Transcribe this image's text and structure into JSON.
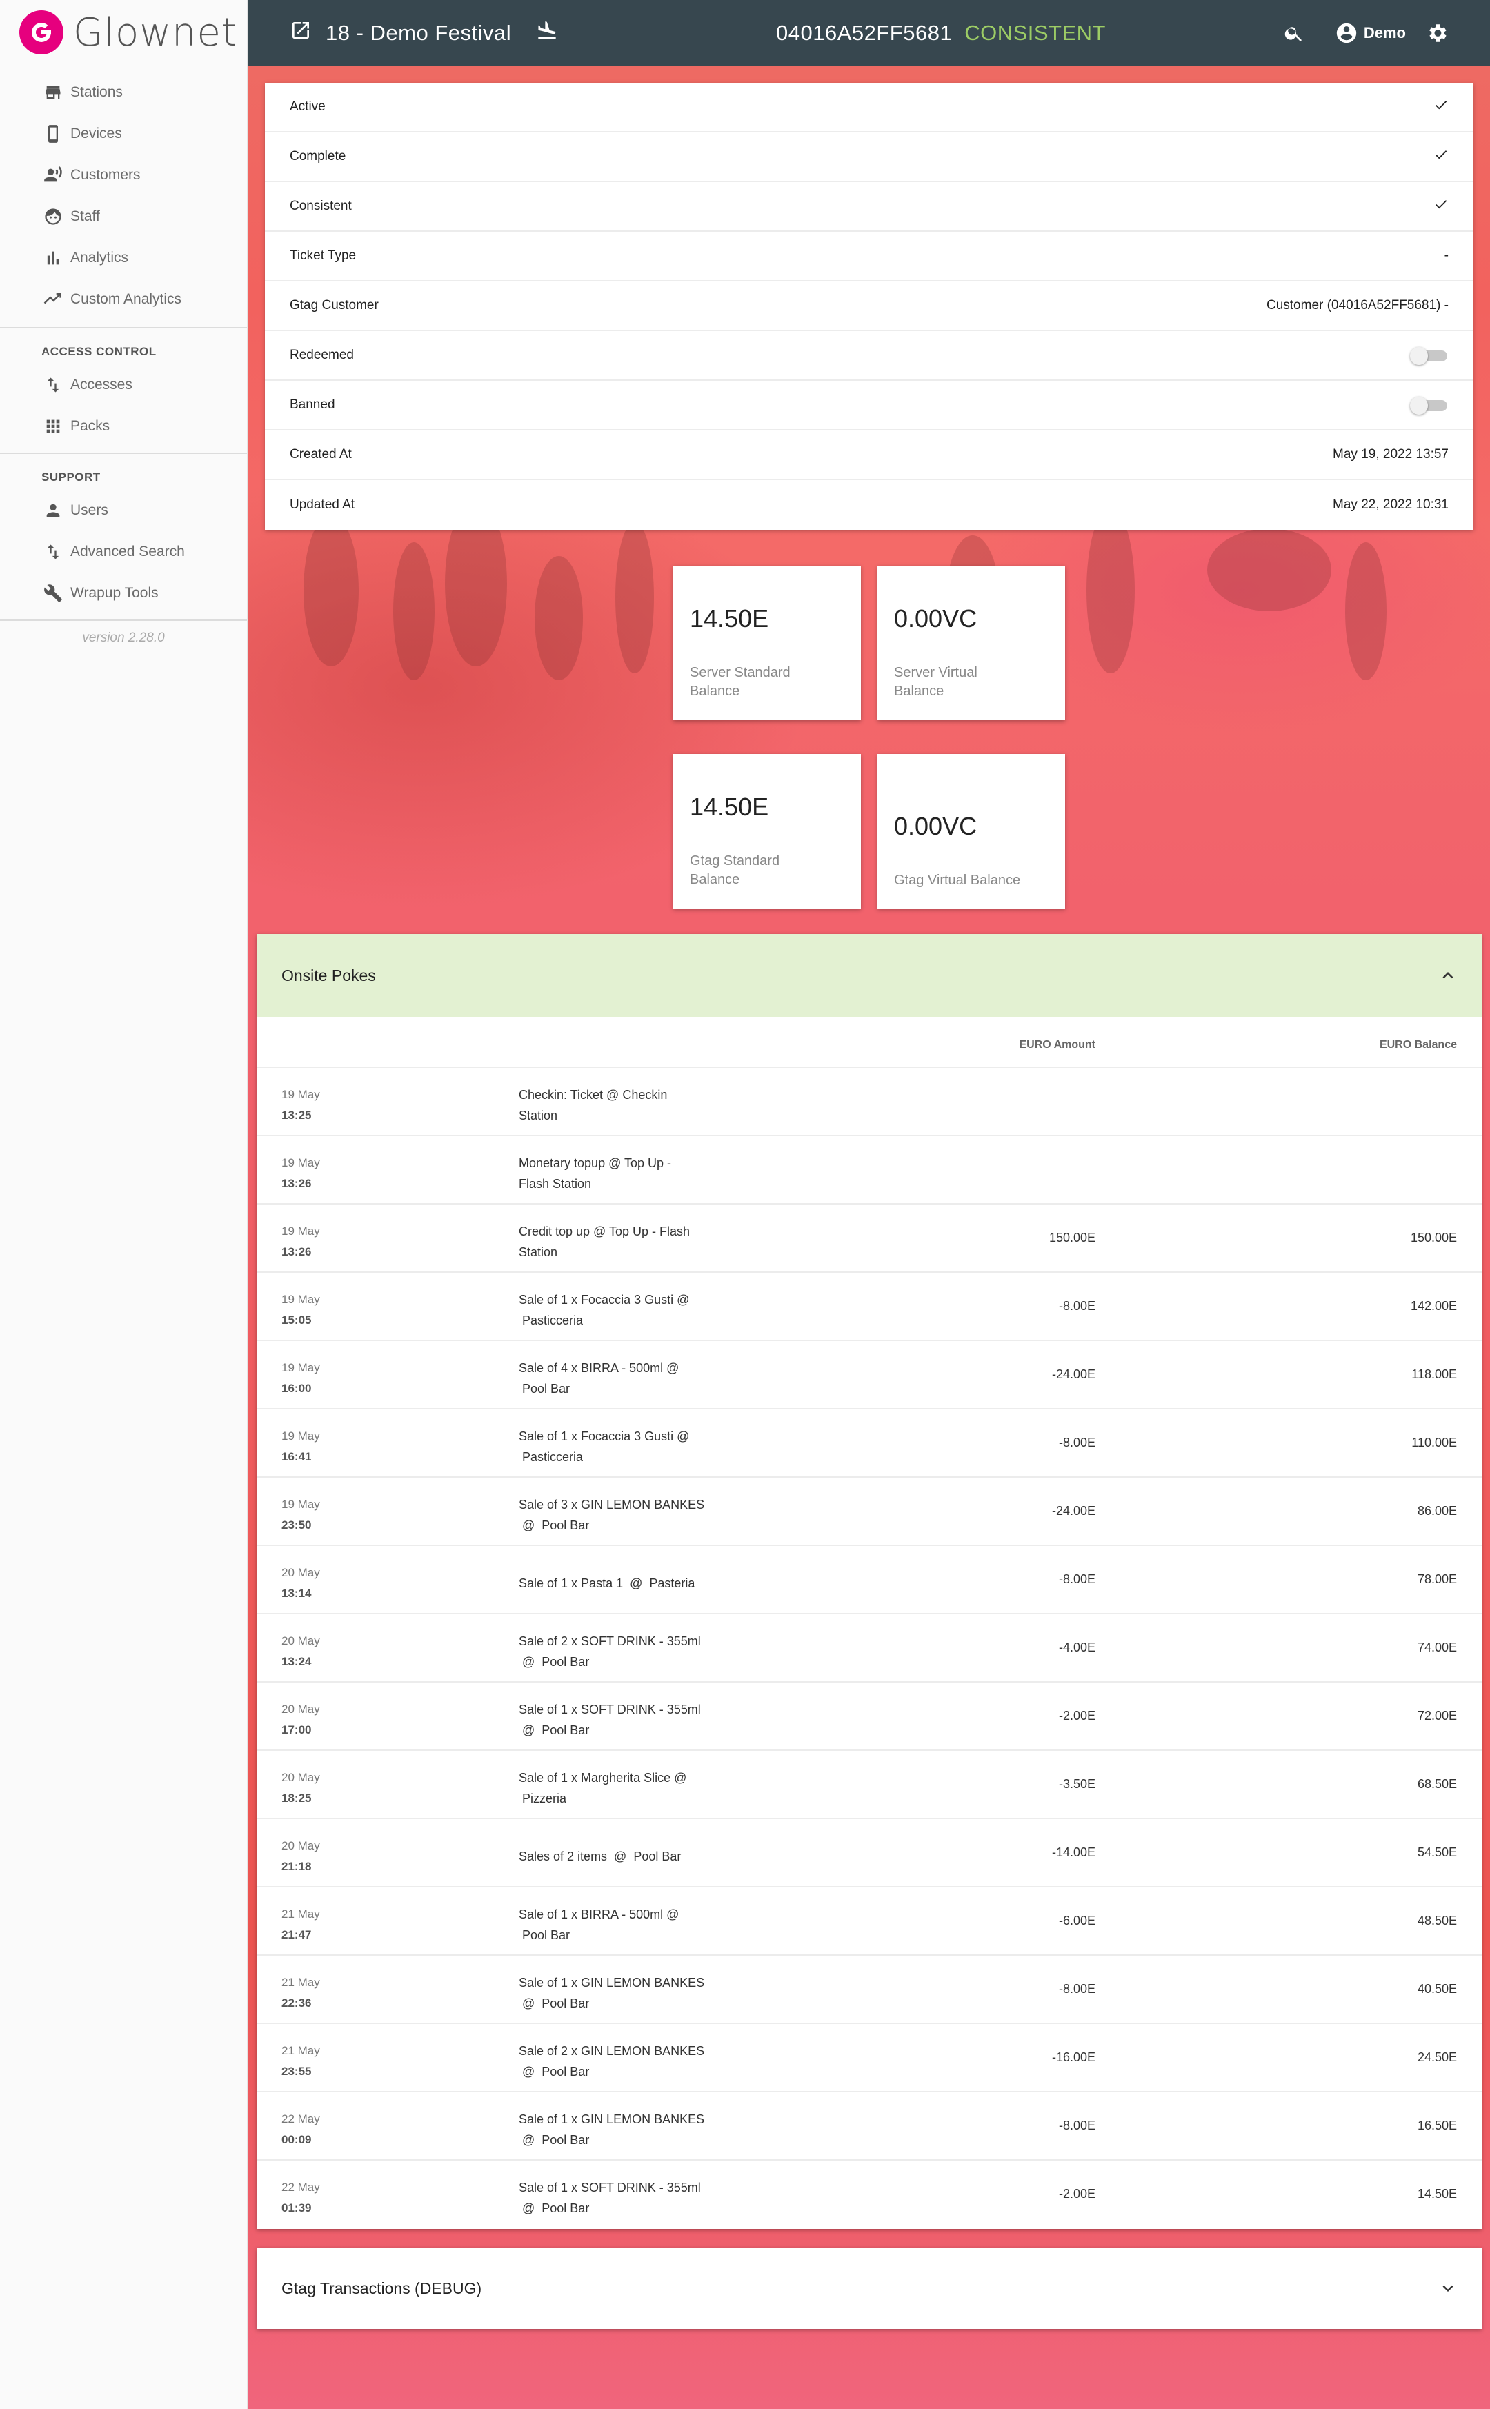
{
  "brand": {
    "name": "Glownet",
    "color": "#e6007e"
  },
  "sidebar": {
    "items": [
      {
        "label": "Stations",
        "icon": "store-icon"
      },
      {
        "label": "Devices",
        "icon": "phone-icon"
      },
      {
        "label": "Customers",
        "icon": "customers-icon"
      },
      {
        "label": "Staff",
        "icon": "face-icon"
      },
      {
        "label": "Analytics",
        "icon": "bar-chart-icon"
      },
      {
        "label": "Custom Analytics",
        "icon": "trend-icon"
      }
    ],
    "access_heading": "ACCESS CONTROL",
    "access_items": [
      {
        "label": "Accesses",
        "icon": "swap-icon"
      },
      {
        "label": "Packs",
        "icon": "grid-icon"
      }
    ],
    "support_heading": "SUPPORT",
    "support_items": [
      {
        "label": "Users",
        "icon": "person-icon"
      },
      {
        "label": "Advanced Search",
        "icon": "swap-icon"
      },
      {
        "label": "Wrapup Tools",
        "icon": "wrench-icon"
      }
    ],
    "version": "version 2.28.0"
  },
  "topbar": {
    "event": "18 - Demo Festival",
    "gtag_uid": "04016A52FF5681",
    "status": "CONSISTENT",
    "status_color": "#9ccc65",
    "user": "Demo"
  },
  "details": [
    {
      "label": "Active",
      "value": "",
      "kind": "check"
    },
    {
      "label": "Complete",
      "value": "",
      "kind": "check"
    },
    {
      "label": "Consistent",
      "value": "",
      "kind": "check"
    },
    {
      "label": "Ticket Type",
      "value": "-",
      "kind": "text"
    },
    {
      "label": "Gtag Customer",
      "value": "Customer (04016A52FF5681) -",
      "kind": "text"
    },
    {
      "label": "Redeemed",
      "value": "",
      "kind": "toggle"
    },
    {
      "label": "Banned",
      "value": "",
      "kind": "toggle"
    },
    {
      "label": "Created At",
      "value": "May 19, 2022 13:57",
      "kind": "text"
    },
    {
      "label": "Updated At",
      "value": "May 22, 2022 10:31",
      "kind": "text"
    }
  ],
  "balances": {
    "server_standard": {
      "amount": "14.50E",
      "label": "Server Standard Balance"
    },
    "server_virtual": {
      "amount": "0.00VC",
      "label": "Server Virtual Balance"
    },
    "gtag_standard": {
      "amount": "14.50E",
      "label": "Gtag Standard Balance"
    },
    "gtag_virtual": {
      "amount": "0.00VC",
      "label": "Gtag Virtual Balance"
    }
  },
  "pokes": {
    "title": "Onsite Pokes",
    "columns": {
      "amount": "EURO Amount",
      "balance": "EURO Balance"
    },
    "rows": [
      {
        "day": "19 May",
        "time": "13:25",
        "desc1": "Checkin: Ticket  @  Checkin",
        "desc2": "Station",
        "amount": "",
        "balance": ""
      },
      {
        "day": "19 May",
        "time": "13:26",
        "desc1": "Monetary topup  @  Top Up -",
        "desc2": "Flash Station",
        "amount": "",
        "balance": ""
      },
      {
        "day": "19 May",
        "time": "13:26",
        "desc1": "Credit top up  @  Top Up - Flash",
        "desc2": "Station",
        "amount": "150.00E",
        "balance": "150.00E"
      },
      {
        "day": "19 May",
        "time": "15:05",
        "desc1": "Sale of 1 x Focaccia 3 Gusti  @",
        "desc2": " Pasticceria",
        "amount": "-8.00E",
        "balance": "142.00E"
      },
      {
        "day": "19 May",
        "time": "16:00",
        "desc1": "Sale of 4 x BIRRA - 500ml  @",
        "desc2": " Pool Bar",
        "amount": "-24.00E",
        "balance": "118.00E"
      },
      {
        "day": "19 May",
        "time": "16:41",
        "desc1": "Sale of 1 x Focaccia 3 Gusti  @",
        "desc2": " Pasticceria",
        "amount": "-8.00E",
        "balance": "110.00E"
      },
      {
        "day": "19 May",
        "time": "23:50",
        "desc1": "Sale of 3 x GIN LEMON BANKES",
        "desc2": " @  Pool Bar",
        "amount": "-24.00E",
        "balance": "86.00E"
      },
      {
        "day": "20 May",
        "time": "13:14",
        "desc1": "",
        "desc2": "Sale of 1 x Pasta 1  @  Pasteria",
        "amount": "-8.00E",
        "balance": "78.00E",
        "single": true
      },
      {
        "day": "20 May",
        "time": "13:24",
        "desc1": "Sale of 2 x SOFT DRINK - 355ml",
        "desc2": " @  Pool Bar",
        "amount": "-4.00E",
        "balance": "74.00E"
      },
      {
        "day": "20 May",
        "time": "17:00",
        "desc1": "Sale of 1 x SOFT DRINK - 355ml",
        "desc2": " @  Pool Bar",
        "amount": "-2.00E",
        "balance": "72.00E"
      },
      {
        "day": "20 May",
        "time": "18:25",
        "desc1": "Sale of 1 x Margherita Slice  @",
        "desc2": " Pizzeria",
        "amount": "-3.50E",
        "balance": "68.50E"
      },
      {
        "day": "20 May",
        "time": "21:18",
        "desc1": "",
        "desc2": "Sales of 2 items  @  Pool Bar",
        "amount": "-14.00E",
        "balance": "54.50E",
        "single": true
      },
      {
        "day": "21 May",
        "time": "21:47",
        "desc1": "Sale of 1 x BIRRA - 500ml  @",
        "desc2": " Pool Bar",
        "amount": "-6.00E",
        "balance": "48.50E"
      },
      {
        "day": "21 May",
        "time": "22:36",
        "desc1": "Sale of 1 x GIN LEMON BANKES",
        "desc2": " @  Pool Bar",
        "amount": "-8.00E",
        "balance": "40.50E"
      },
      {
        "day": "21 May",
        "time": "23:55",
        "desc1": "Sale of 2 x GIN LEMON BANKES",
        "desc2": " @  Pool Bar",
        "amount": "-16.00E",
        "balance": "24.50E"
      },
      {
        "day": "22 May",
        "time": "00:09",
        "desc1": "Sale of 1 x GIN LEMON BANKES",
        "desc2": " @  Pool Bar",
        "amount": "-8.00E",
        "balance": "16.50E"
      },
      {
        "day": "22 May",
        "time": "01:39",
        "desc1": "Sale of 1 x SOFT DRINK - 355ml",
        "desc2": " @  Pool Bar",
        "amount": "-2.00E",
        "balance": "14.50E"
      }
    ]
  },
  "debug": {
    "title": "Gtag Transactions (DEBUG)"
  }
}
